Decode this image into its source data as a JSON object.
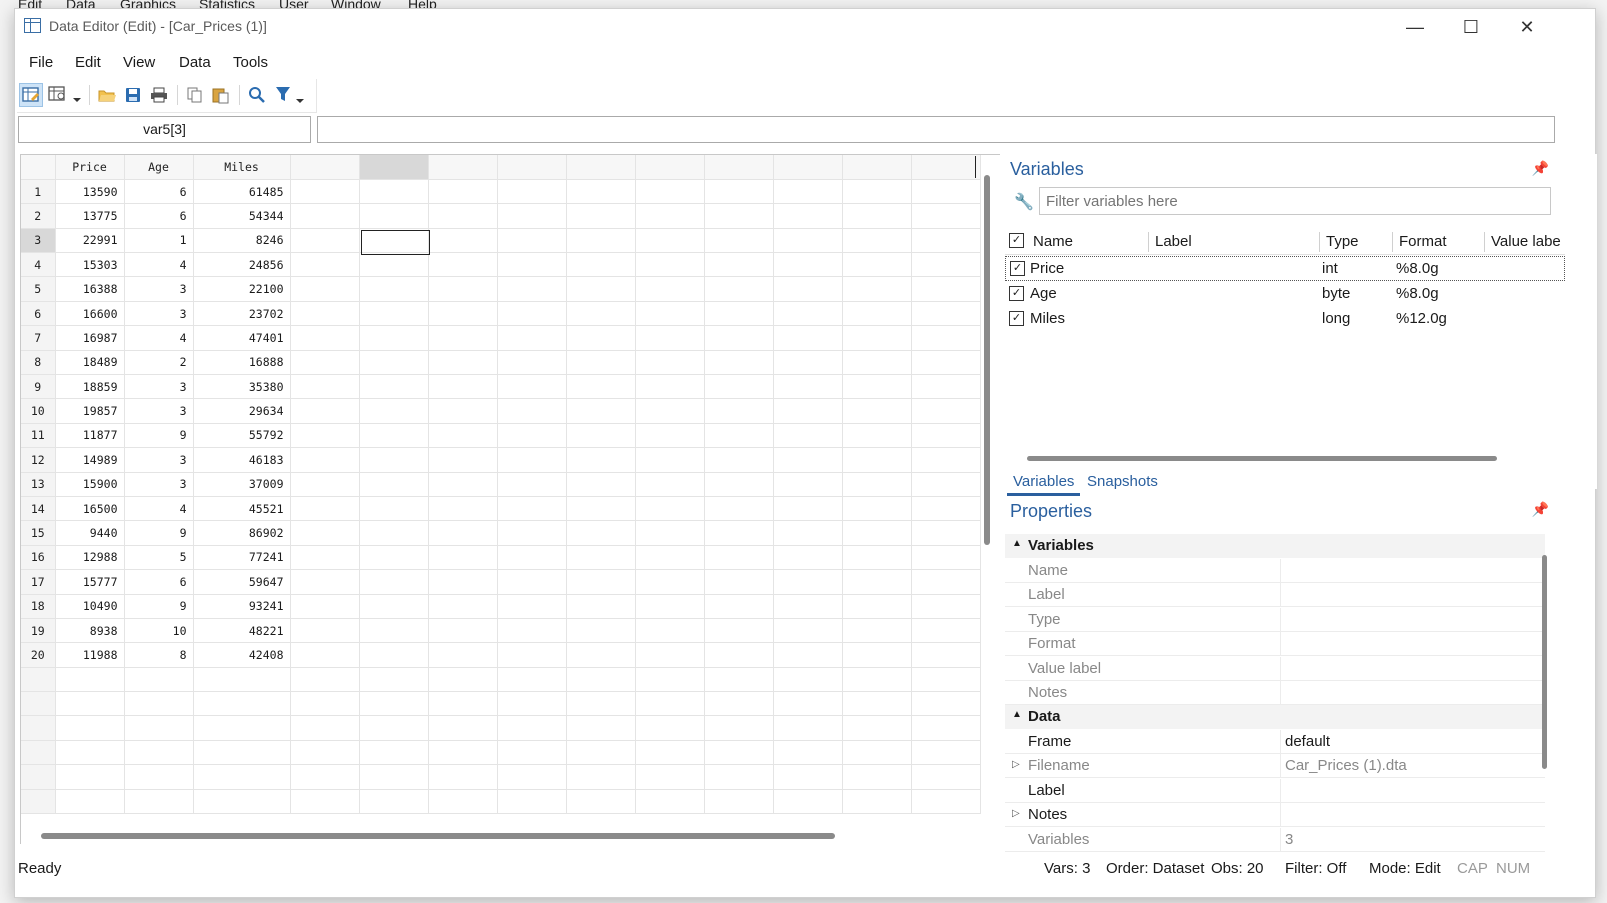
{
  "background_menu": [
    "Edit",
    "Data",
    "Graphics",
    "Statistics",
    "User",
    "Window",
    "Help"
  ],
  "window": {
    "title": "Data Editor (Edit) - [Car_Prices (1)]",
    "menu": [
      "File",
      "Edit",
      "View",
      "Data",
      "Tools"
    ]
  },
  "toolbar_icons": [
    "edit-mode-icon",
    "browse-mode-icon",
    "open-icon",
    "save-icon",
    "print-icon",
    "copy-icon",
    "paste-icon",
    "find-icon",
    "filter-icon"
  ],
  "cell_reference": "var5[3]",
  "cell_value": "",
  "grid": {
    "columns": [
      "Price",
      "Age",
      "Miles"
    ],
    "selected_row": 3,
    "selected_column": "var5",
    "rows": [
      [
        "1",
        "13590",
        "6",
        "61485"
      ],
      [
        "2",
        "13775",
        "6",
        "54344"
      ],
      [
        "3",
        "22991",
        "1",
        "8246"
      ],
      [
        "4",
        "15303",
        "4",
        "24856"
      ],
      [
        "5",
        "16388",
        "3",
        "22100"
      ],
      [
        "6",
        "16600",
        "3",
        "23702"
      ],
      [
        "7",
        "16987",
        "4",
        "47401"
      ],
      [
        "8",
        "18489",
        "2",
        "16888"
      ],
      [
        "9",
        "18859",
        "3",
        "35380"
      ],
      [
        "10",
        "19857",
        "3",
        "29634"
      ],
      [
        "11",
        "11877",
        "9",
        "55792"
      ],
      [
        "12",
        "14989",
        "3",
        "46183"
      ],
      [
        "13",
        "15900",
        "3",
        "37009"
      ],
      [
        "14",
        "16500",
        "4",
        "45521"
      ],
      [
        "15",
        "9440",
        "9",
        "86902"
      ],
      [
        "16",
        "12988",
        "5",
        "77241"
      ],
      [
        "17",
        "15777",
        "6",
        "59647"
      ],
      [
        "18",
        "10490",
        "9",
        "93241"
      ],
      [
        "19",
        "8938",
        "10",
        "48221"
      ],
      [
        "20",
        "11988",
        "8",
        "42408"
      ]
    ]
  },
  "variables_panel": {
    "title": "Variables",
    "filter_placeholder": "Filter variables here",
    "headers": {
      "name": "Name",
      "label": "Label",
      "type": "Type",
      "format": "Format",
      "value_label": "Value labe"
    },
    "items": [
      {
        "name": "Price",
        "label": "",
        "type": "int",
        "format": "%8.0g"
      },
      {
        "name": "Age",
        "label": "",
        "type": "byte",
        "format": "%8.0g"
      },
      {
        "name": "Miles",
        "label": "",
        "type": "long",
        "format": "%12.0g"
      }
    ]
  },
  "tabs": {
    "variables": "Variables",
    "snapshots": "Snapshots"
  },
  "properties_panel": {
    "title": "Properties",
    "variables_section": "Variables",
    "variables_fields": [
      "Name",
      "Label",
      "Type",
      "Format",
      "Value label",
      "Notes"
    ],
    "data_section": "Data",
    "data_fields": {
      "frame_key": "Frame",
      "frame_val": "default",
      "filename_key": "Filename",
      "filename_val": "Car_Prices (1).dta",
      "label_key": "Label",
      "label_val": "",
      "notes_key": "Notes",
      "notes_val": "",
      "variables_key": "Variables",
      "variables_val": "3"
    }
  },
  "status": {
    "ready": "Ready",
    "vars": "Vars: 3",
    "order": "Order: Dataset",
    "obs": "Obs: 20",
    "filter": "Filter: Off",
    "mode": "Mode: Edit",
    "cap": "CAP",
    "num": "NUM"
  },
  "colors": {
    "accent": "#2a5f9e",
    "selection": "#d8d8d8"
  }
}
